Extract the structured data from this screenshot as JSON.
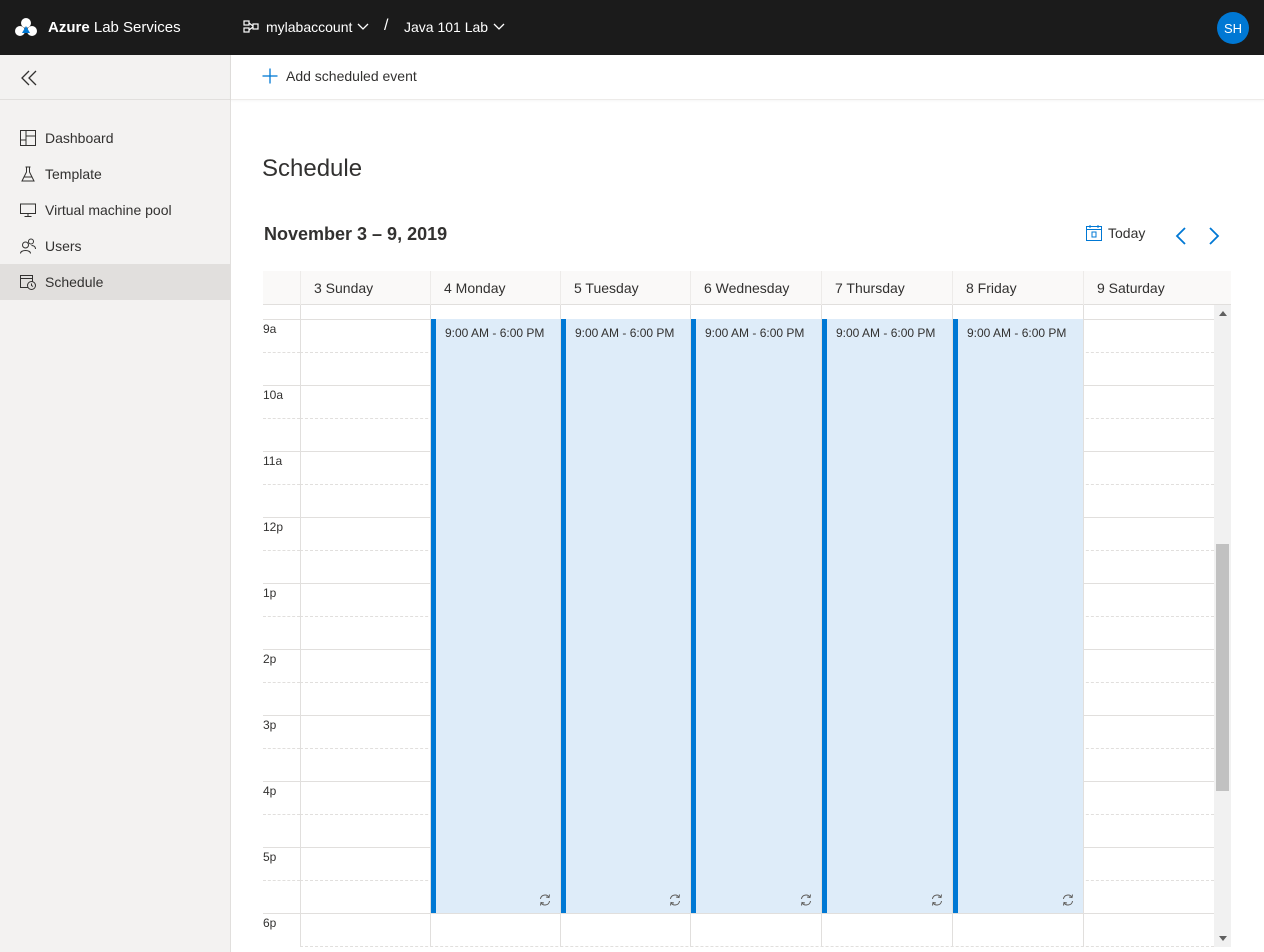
{
  "header": {
    "brand_bold": "Azure",
    "brand_rest": " Lab Services",
    "account": "mylabaccount",
    "separator": "/",
    "lab": "Java 101 Lab",
    "avatar_initials": "SH",
    "accent_color": "#0078d4",
    "bg_color": "#1b1b1b"
  },
  "sidebar": {
    "collapse_icon": "double-chevron-left-icon",
    "items": [
      {
        "label": "Dashboard",
        "icon": "dashboard-icon",
        "active": false
      },
      {
        "label": "Template",
        "icon": "flask-icon",
        "active": false
      },
      {
        "label": "Virtual machine pool",
        "icon": "monitor-icon",
        "active": false
      },
      {
        "label": "Users",
        "icon": "users-icon",
        "active": false
      },
      {
        "label": "Schedule",
        "icon": "calendar-clock-icon",
        "active": true
      }
    ]
  },
  "command_bar": {
    "add_label": "Add scheduled event",
    "add_icon": "plus-icon"
  },
  "main": {
    "title": "Schedule",
    "week_range": "November 3 – 9, 2019",
    "today_label": "Today",
    "today_icon": "calendar-today-icon",
    "prev_icon": "chevron-left-icon",
    "next_icon": "chevron-right-icon"
  },
  "calendar": {
    "days": [
      "3 Sunday",
      "4 Monday",
      "5 Tuesday",
      "6 Wednesday",
      "7 Thursday",
      "8 Friday",
      "9 Saturday"
    ],
    "hours": [
      "9a",
      "10a",
      "11a",
      "12p",
      "1p",
      "2p",
      "3p",
      "4p",
      "5p",
      "6p"
    ],
    "events": [
      {
        "day": "4 Monday",
        "time": "9:00 AM - 6:00 PM",
        "recurring": true
      },
      {
        "day": "5 Tuesday",
        "time": "9:00 AM - 6:00 PM",
        "recurring": true
      },
      {
        "day": "6 Wednesday",
        "time": "9:00 AM - 6:00 PM",
        "recurring": true
      },
      {
        "day": "7 Thursday",
        "time": "9:00 AM - 6:00 PM",
        "recurring": true
      },
      {
        "day": "8 Friday",
        "time": "9:00 AM - 6:00 PM",
        "recurring": true
      }
    ],
    "event_color": "#deecf9",
    "event_border_color": "#0078d4"
  }
}
